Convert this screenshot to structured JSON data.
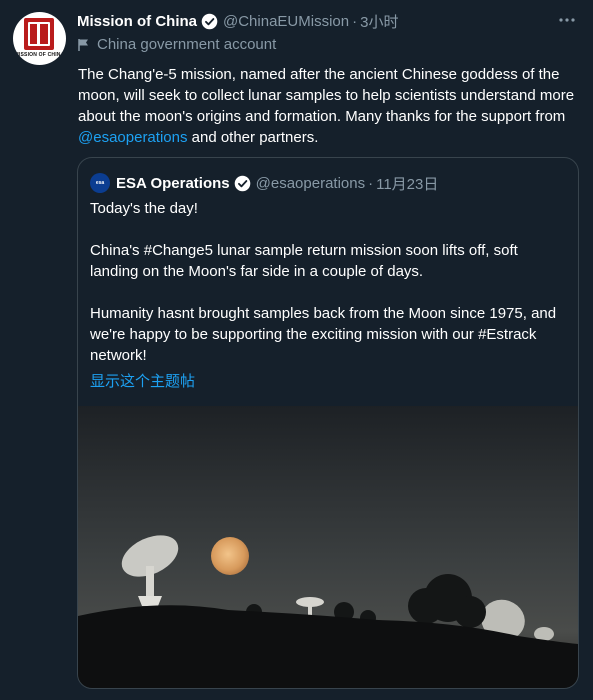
{
  "tweet": {
    "avatar": {
      "icon": "mission-of-china-logo",
      "logo_text": "MISSION OF CHINA"
    },
    "display_name": "Mission of China",
    "handle": "@ChinaEUMission",
    "dot": "·",
    "time": "3小时",
    "more_icon": "ellipsis-icon",
    "account_label": "China government account",
    "text_before": "The Chang'e-5 mission, named after the ancient Chinese goddess of the moon, will seek to collect lunar samples to help scientists understand more about the moon's origins and formation. Many thanks for the support from ",
    "mention": "@esaoperations",
    "text_after": " and other partners."
  },
  "quote": {
    "avatar_text": "esa",
    "display_name": "ESA Operations",
    "handle": "@esaoperations",
    "dot": "·",
    "time": "11月23日",
    "lines": [
      "Today's the day!",
      "China's #Change5 lunar sample return mission soon lifts off, soft landing on the Moon's far side in a couple of days.",
      "Humanity hasnt brought samples back from the Moon since 1975, and we're happy to be supporting the exciting mission with our #Estrack network!"
    ],
    "show_thread": "显示这个主题帖",
    "media": {
      "description_icon": "photo-antennas-moon"
    }
  },
  "colors": {
    "background": "#15202b",
    "text": "#ffffff",
    "secondary": "#8899a6",
    "accent": "#1da1f2",
    "border": "#38444d"
  }
}
